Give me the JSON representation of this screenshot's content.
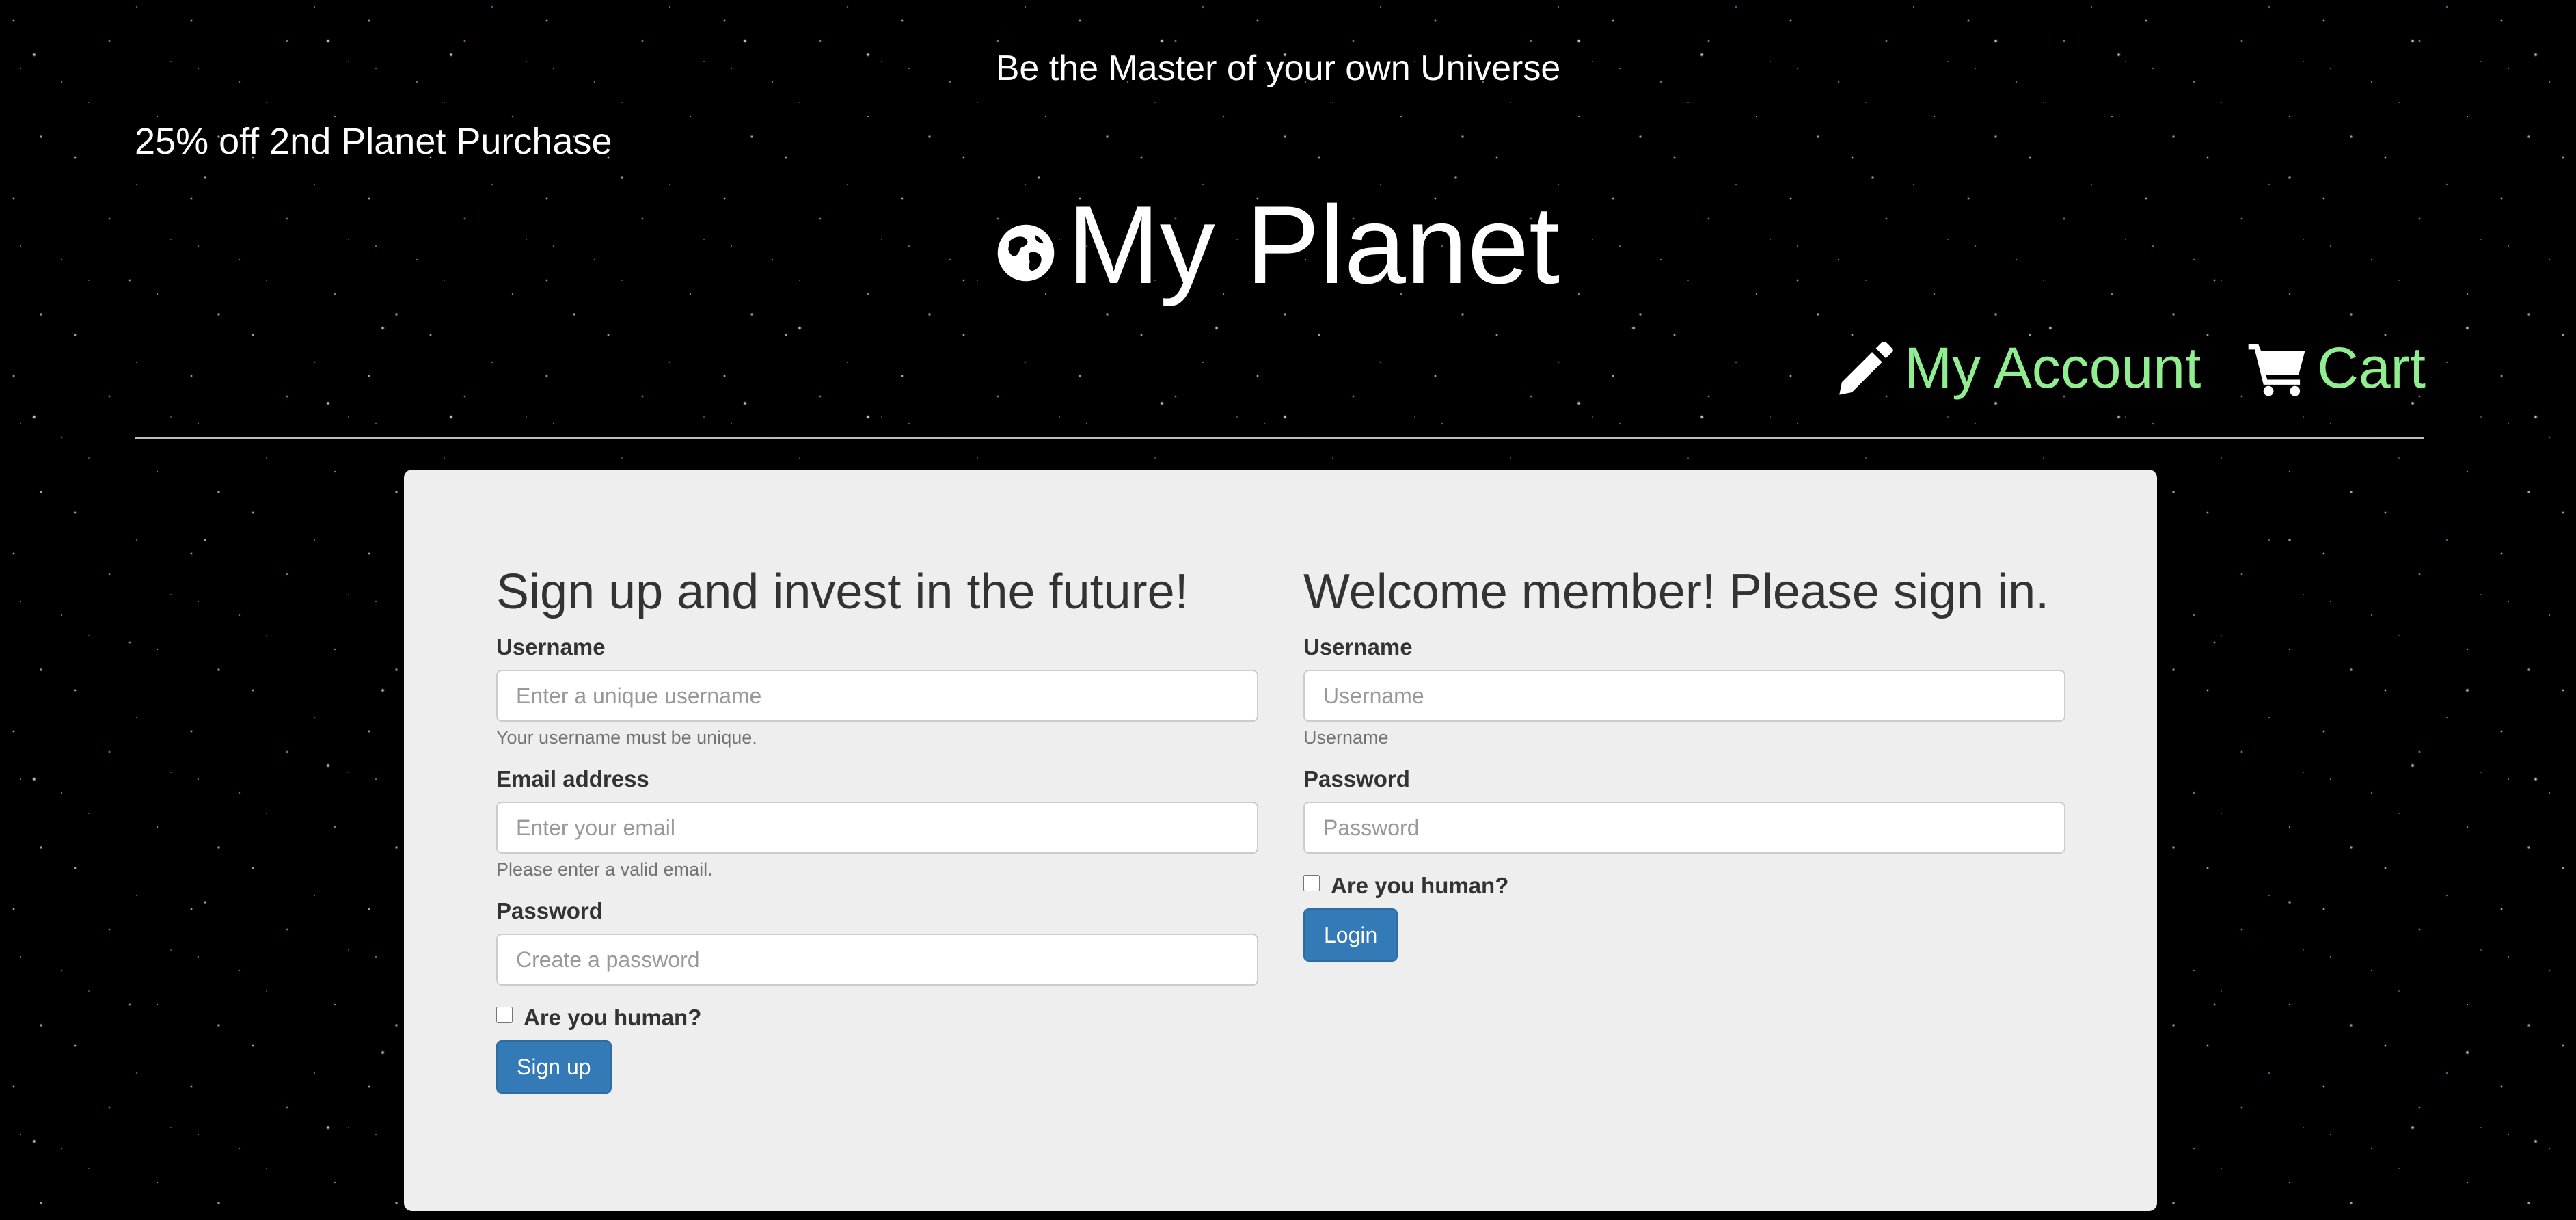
{
  "header": {
    "tagline": "Be the Master of your own Universe",
    "promo": "25% off 2nd Planet Purchase",
    "brand_title": "My Planet",
    "brand_icon": "globe-icon"
  },
  "nav": {
    "account_label": "My Account",
    "account_icon": "pencil-icon",
    "cart_label": "Cart",
    "cart_icon": "shopping-cart-icon",
    "link_color": "#90ee90"
  },
  "signup": {
    "heading": "Sign up and invest in the future!",
    "username_label": "Username",
    "username_placeholder": "Enter a unique username",
    "username_help": "Your username must be unique.",
    "email_label": "Email address",
    "email_placeholder": "Enter your email",
    "email_help": "Please enter a valid email.",
    "password_label": "Password",
    "password_placeholder": "Create a password",
    "human_label": "Are you human?",
    "submit_label": "Sign up"
  },
  "login": {
    "heading": "Welcome member! Please sign in.",
    "username_label": "Username",
    "username_placeholder": "Username",
    "username_help": "Username",
    "password_label": "Password",
    "password_placeholder": "Password",
    "human_label": "Are you human?",
    "submit_label": "Login"
  },
  "colors": {
    "background": "#000000",
    "panel": "#eeeeee",
    "primary_button": "#337ab7"
  }
}
